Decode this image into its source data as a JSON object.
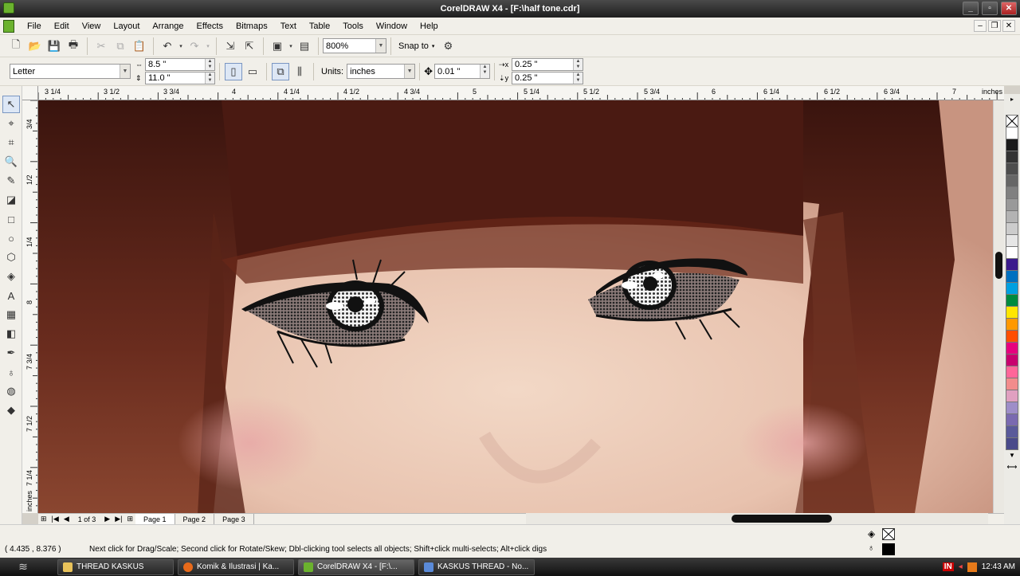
{
  "window": {
    "title": "CorelDRAW X4 - [F:\\half tone.cdr]"
  },
  "menu": [
    "File",
    "Edit",
    "View",
    "Layout",
    "Arrange",
    "Effects",
    "Bitmaps",
    "Text",
    "Table",
    "Tools",
    "Window",
    "Help"
  ],
  "toolbar": {
    "zoom": "800%",
    "snap_to": "Snap to"
  },
  "property_bar": {
    "page_size": "Letter",
    "width": "8.5 \"",
    "height": "11.0 \"",
    "units_label": "Units:",
    "units": "inches",
    "nudge": "0.01 \"",
    "dup_x": "0.25 \"",
    "dup_y": "0.25 \""
  },
  "ruler": {
    "unit": "inches",
    "h_labels": [
      "3 1/4",
      "3 1/2",
      "3 3/4",
      "4",
      "4 1/4",
      "4 1/2",
      "4 3/4",
      "5",
      "5 1/4",
      "5 1/2",
      "5 3/4",
      "6",
      "6 1/4",
      "6 1/2",
      "6 3/4",
      "7"
    ],
    "v_labels": [
      "3/4",
      "1/2",
      "1/4",
      "8",
      "7 3/4",
      "7 1/2",
      "7 1/4"
    ],
    "v_unit": "inches"
  },
  "pages": {
    "indicator": "1 of 3",
    "tabs": [
      "Page 1",
      "Page 2",
      "Page 3"
    ]
  },
  "status": {
    "coords": "( 4.435 , 8.376 )",
    "hint": "Next click for Drag/Scale; Second click for Rotate/Skew; Dbl-clicking tool selects all objects; Shift+click multi-selects; Alt+click digs"
  },
  "palette": [
    "#ffffff",
    "#1a1a1a",
    "#333333",
    "#4d4d4d",
    "#666666",
    "#808080",
    "#999999",
    "#b3b3b3",
    "#cccccc",
    "#e6e6e6",
    "#ffffff",
    "#3a1a8c",
    "#0070c0",
    "#00a0e0",
    "#008a3e",
    "#ffe600",
    "#ff9900",
    "#ff4d00",
    "#e6007e",
    "#c8006e",
    "#ff6699",
    "#f28c8c",
    "#e0a0c0",
    "#9e8ec8",
    "#7a6ab0",
    "#5a5a9a",
    "#4a4a8a"
  ],
  "taskbar": {
    "tasks": [
      "THREAD KASKUS",
      "Komik & Ilustrasi | Ka...",
      "CorelDRAW X4 - [F:\\...",
      "KASKUS THREAD - No..."
    ],
    "lang": "IN",
    "clock": "12:43 AM"
  },
  "colors": {
    "titlebar": "#2a2a2a",
    "toolbar_bg": "#f1efe9",
    "canvas_hair": "#5a2418"
  }
}
